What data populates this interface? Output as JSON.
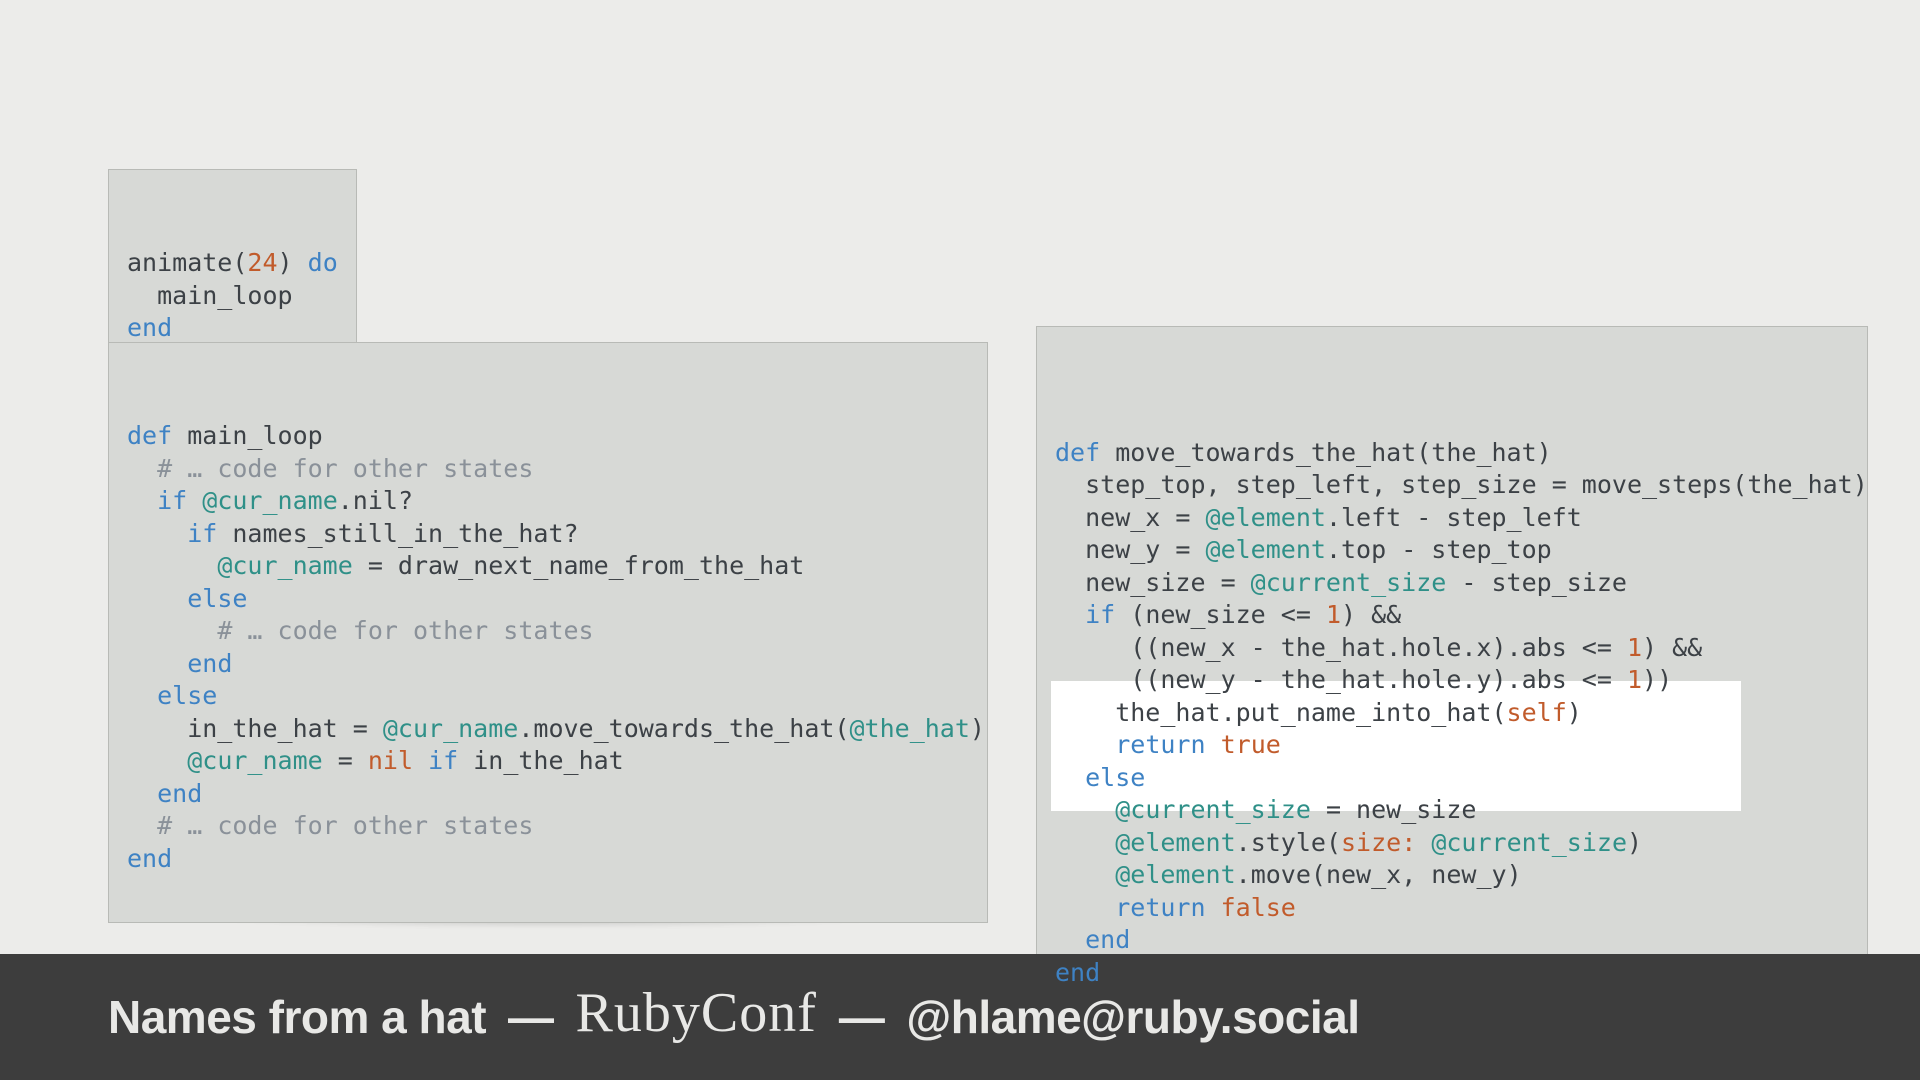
{
  "cards": {
    "animate": {
      "tokens": [
        {
          "t": "animate(",
          "c": "id"
        },
        {
          "t": "24",
          "c": "num"
        },
        {
          "t": ") ",
          "c": "id"
        },
        {
          "t": "do",
          "c": "kw"
        },
        {
          "t": "\n"
        },
        {
          "t": "  main_loop",
          "c": "id"
        },
        {
          "t": "\n"
        },
        {
          "t": "end",
          "c": "kw"
        }
      ]
    },
    "main_loop": {
      "tokens": [
        {
          "t": "def",
          "c": "kw"
        },
        {
          "t": " main_loop",
          "c": "id"
        },
        {
          "t": "\n"
        },
        {
          "t": "  "
        },
        {
          "t": "# … code for other states",
          "c": "cmnt"
        },
        {
          "t": "\n"
        },
        {
          "t": "  "
        },
        {
          "t": "if",
          "c": "kw"
        },
        {
          "t": " "
        },
        {
          "t": "@cur_name",
          "c": "ivar"
        },
        {
          "t": ".nil?",
          "c": "id"
        },
        {
          "t": "\n"
        },
        {
          "t": "    "
        },
        {
          "t": "if",
          "c": "kw"
        },
        {
          "t": " names_still_in_the_hat?",
          "c": "id"
        },
        {
          "t": "\n"
        },
        {
          "t": "      "
        },
        {
          "t": "@cur_name",
          "c": "ivar"
        },
        {
          "t": " = draw_next_name_from_the_hat",
          "c": "id"
        },
        {
          "t": "\n"
        },
        {
          "t": "    "
        },
        {
          "t": "else",
          "c": "kw"
        },
        {
          "t": "\n"
        },
        {
          "t": "      "
        },
        {
          "t": "# … code for other states",
          "c": "cmnt"
        },
        {
          "t": "\n"
        },
        {
          "t": "    "
        },
        {
          "t": "end",
          "c": "kw"
        },
        {
          "t": "\n"
        },
        {
          "t": "  "
        },
        {
          "t": "else",
          "c": "kw"
        },
        {
          "t": "\n"
        },
        {
          "t": "    in_the_hat = ",
          "c": "id"
        },
        {
          "t": "@cur_name",
          "c": "ivar"
        },
        {
          "t": ".move_towards_the_hat(",
          "c": "id"
        },
        {
          "t": "@the_hat",
          "c": "ivar"
        },
        {
          "t": ")",
          "c": "id"
        },
        {
          "t": "\n"
        },
        {
          "t": "    "
        },
        {
          "t": "@cur_name",
          "c": "ivar"
        },
        {
          "t": " = ",
          "c": "id"
        },
        {
          "t": "nil",
          "c": "bool"
        },
        {
          "t": " "
        },
        {
          "t": "if",
          "c": "kw"
        },
        {
          "t": " in_the_hat",
          "c": "id"
        },
        {
          "t": "\n"
        },
        {
          "t": "  "
        },
        {
          "t": "end",
          "c": "kw"
        },
        {
          "t": "\n"
        },
        {
          "t": "  "
        },
        {
          "t": "# … code for other states",
          "c": "cmnt"
        },
        {
          "t": "\n"
        },
        {
          "t": "end",
          "c": "kw"
        }
      ]
    },
    "move_towards": {
      "tokens": [
        {
          "t": "def",
          "c": "kw"
        },
        {
          "t": " move_towards_the_hat(the_hat)",
          "c": "id"
        },
        {
          "t": "\n"
        },
        {
          "t": "  step_top, step_left, step_size = move_steps(the_hat)",
          "c": "id"
        },
        {
          "t": "\n"
        },
        {
          "t": "  new_x = ",
          "c": "id"
        },
        {
          "t": "@element",
          "c": "ivar"
        },
        {
          "t": ".left - step_left",
          "c": "id"
        },
        {
          "t": "\n"
        },
        {
          "t": "  new_y = ",
          "c": "id"
        },
        {
          "t": "@element",
          "c": "ivar"
        },
        {
          "t": ".top - step_top",
          "c": "id"
        },
        {
          "t": "\n"
        },
        {
          "t": "  new_size = ",
          "c": "id"
        },
        {
          "t": "@current_size",
          "c": "ivar"
        },
        {
          "t": " - step_size",
          "c": "id"
        },
        {
          "t": "\n"
        },
        {
          "t": "  "
        },
        {
          "t": "if",
          "c": "kw"
        },
        {
          "t": " (new_size <= ",
          "c": "id"
        },
        {
          "t": "1",
          "c": "num"
        },
        {
          "t": ") &&",
          "c": "id"
        },
        {
          "t": "\n"
        },
        {
          "t": "     ((new_x - the_hat.hole.x).abs <= ",
          "c": "id"
        },
        {
          "t": "1",
          "c": "num"
        },
        {
          "t": ") &&",
          "c": "id"
        },
        {
          "t": "\n"
        },
        {
          "t": "     ((new_y - the_hat.hole.y).abs <= ",
          "c": "id"
        },
        {
          "t": "1",
          "c": "num"
        },
        {
          "t": "))",
          "c": "id"
        },
        {
          "t": "\n"
        },
        {
          "t": "    the_hat.put_name_into_hat(",
          "c": "id"
        },
        {
          "t": "self",
          "c": "self"
        },
        {
          "t": ")",
          "c": "id"
        },
        {
          "t": "\n"
        },
        {
          "t": "    "
        },
        {
          "t": "return",
          "c": "kw"
        },
        {
          "t": " "
        },
        {
          "t": "true",
          "c": "bool"
        },
        {
          "t": "\n"
        },
        {
          "t": "  "
        },
        {
          "t": "else",
          "c": "kw"
        },
        {
          "t": "\n"
        },
        {
          "t": "    "
        },
        {
          "t": "@current_size",
          "c": "ivar"
        },
        {
          "t": " = new_size",
          "c": "id"
        },
        {
          "t": "\n"
        },
        {
          "t": "    "
        },
        {
          "t": "@element",
          "c": "ivar"
        },
        {
          "t": ".style(",
          "c": "id"
        },
        {
          "t": "size:",
          "c": "sym"
        },
        {
          "t": " "
        },
        {
          "t": "@current_size",
          "c": "ivar"
        },
        {
          "t": ")",
          "c": "id"
        },
        {
          "t": "\n"
        },
        {
          "t": "    "
        },
        {
          "t": "@element",
          "c": "ivar"
        },
        {
          "t": ".move(new_x, new_y)",
          "c": "id"
        },
        {
          "t": "\n"
        },
        {
          "t": "    "
        },
        {
          "t": "return",
          "c": "kw"
        },
        {
          "t": " "
        },
        {
          "t": "false",
          "c": "bool"
        },
        {
          "t": "\n"
        },
        {
          "t": "  "
        },
        {
          "t": "end",
          "c": "kw"
        },
        {
          "t": "\n"
        },
        {
          "t": "end",
          "c": "kw"
        }
      ]
    }
  },
  "footer": {
    "title": "Names from a hat",
    "sep": "—",
    "logo": "RubyConf",
    "handle": "@hlame@ruby.social"
  }
}
